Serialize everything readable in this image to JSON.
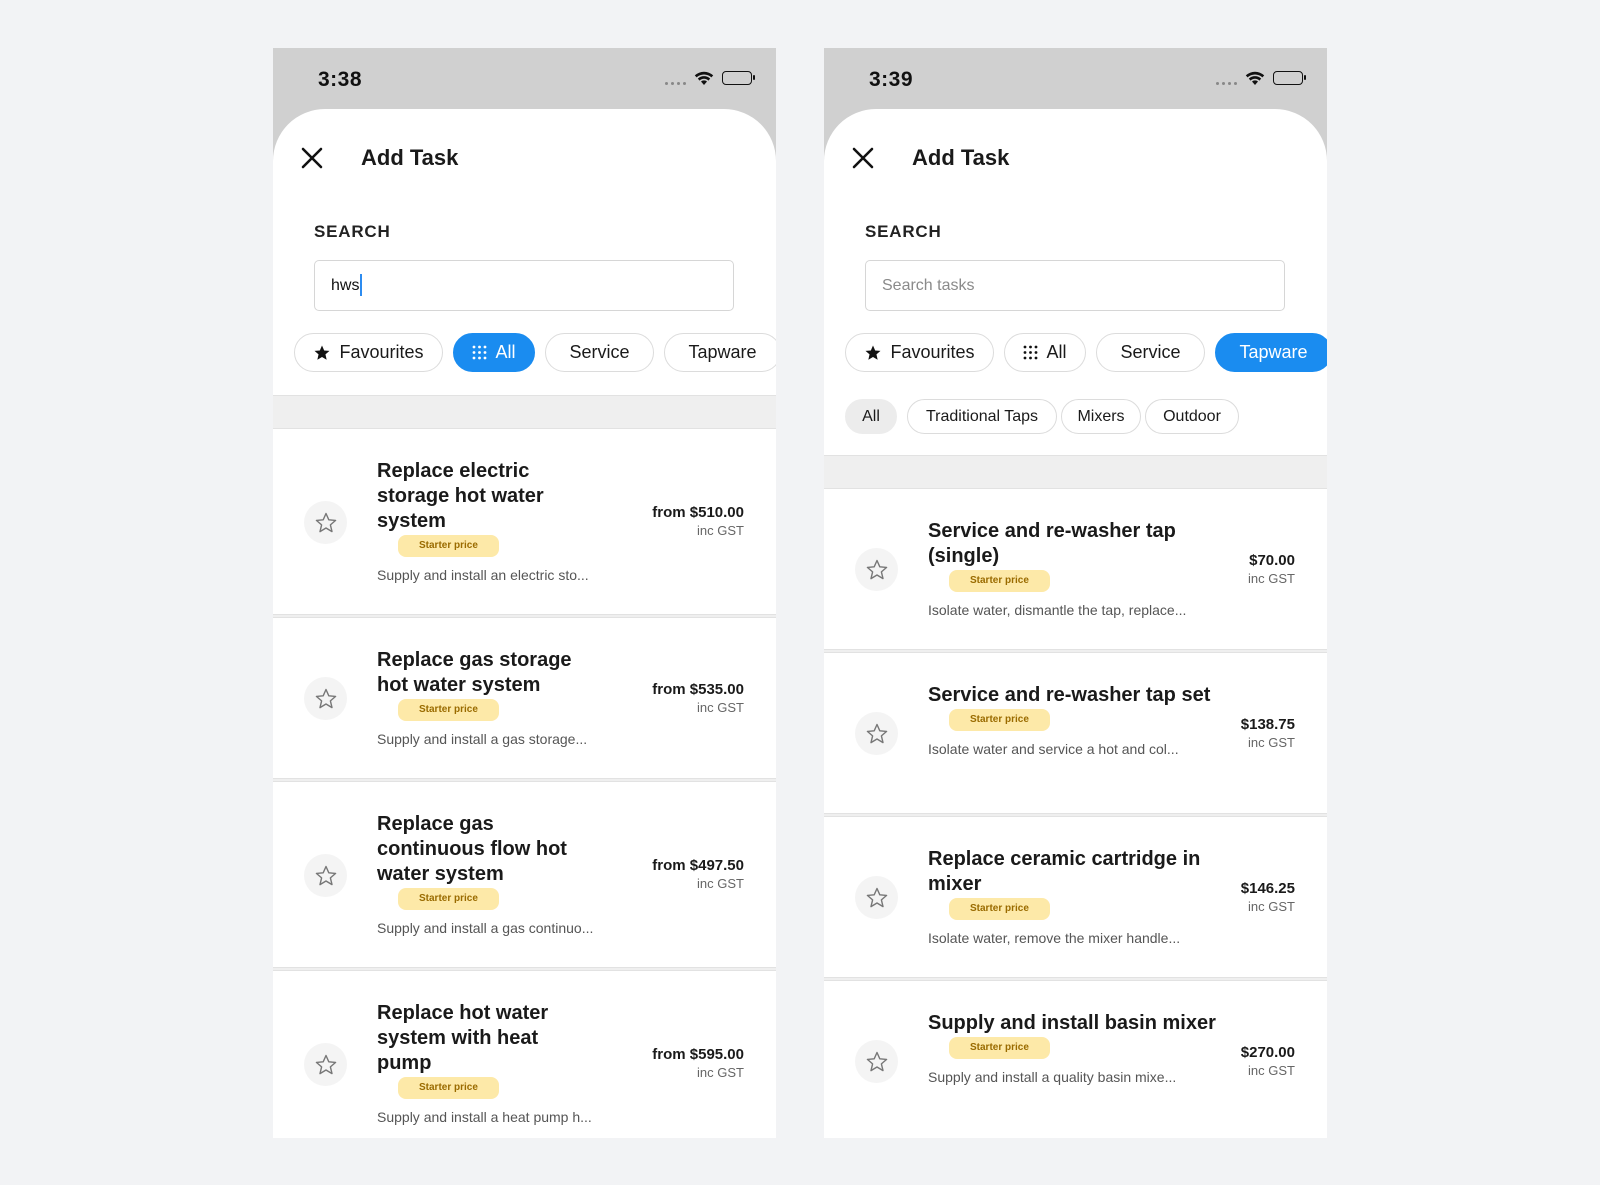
{
  "screens": [
    {
      "status_time": "3:38",
      "title": "Add Task",
      "search_label": "SEARCH",
      "search_value": "hws",
      "search_placeholder": "",
      "chips": [
        {
          "label": "Favourites",
          "icon": "star-filled-icon",
          "active": false
        },
        {
          "label": "All",
          "icon": "grid-dots-icon",
          "active": true
        },
        {
          "label": "Service",
          "icon": "",
          "active": false
        },
        {
          "label": "Tapware",
          "icon": "",
          "active": false
        }
      ],
      "subchips": [],
      "tasks": [
        {
          "title": "Replace electric storage hot water system",
          "badge": "Starter price",
          "desc": "Supply and install an electric sto...",
          "price": "from $510.00",
          "tax": "inc GST"
        },
        {
          "title": "Replace gas storage hot water system",
          "badge": "Starter price",
          "desc": "Supply and install a gas storage...",
          "price": "from $535.00",
          "tax": "inc GST"
        },
        {
          "title": "Replace gas continuous flow hot water system",
          "badge": "Starter price",
          "desc": "Supply and install a gas continuo...",
          "price": "from $497.50",
          "tax": "inc GST"
        },
        {
          "title": "Replace hot water system with heat pump",
          "badge": "Starter price",
          "desc": "Supply and install a heat pump h...",
          "price": "from $595.00",
          "tax": "inc GST"
        }
      ]
    },
    {
      "status_time": "3:39",
      "title": "Add Task",
      "search_label": "SEARCH",
      "search_value": "",
      "search_placeholder": "Search tasks",
      "chips": [
        {
          "label": "Favourites",
          "icon": "star-filled-icon",
          "active": false
        },
        {
          "label": "All",
          "icon": "grid-dots-icon",
          "active": false
        },
        {
          "label": "Service",
          "icon": "",
          "active": false
        },
        {
          "label": "Tapware",
          "icon": "",
          "active": true
        }
      ],
      "subchips": [
        {
          "label": "All",
          "active": true
        },
        {
          "label": "Traditional Taps",
          "active": false
        },
        {
          "label": "Mixers",
          "active": false
        },
        {
          "label": "Outdoor",
          "active": false
        }
      ],
      "tasks": [
        {
          "title": "Service and re-washer tap (single)",
          "badge": "Starter price",
          "desc": "Isolate water, dismantle the tap, replace...",
          "price": "$70.00",
          "tax": "inc GST"
        },
        {
          "title": "Service and re-washer tap set",
          "badge": "Starter price",
          "desc": "Isolate water and service a hot and col...",
          "price": "$138.75",
          "tax": "inc GST"
        },
        {
          "title": "Replace ceramic cartridge in mixer",
          "badge": "Starter price",
          "desc": "Isolate water, remove the mixer handle...",
          "price": "$146.25",
          "tax": "inc GST"
        },
        {
          "title": "Supply and install basin mixer",
          "badge": "Starter price",
          "desc": "Supply and install a quality basin mixe...",
          "price": "$270.00",
          "tax": "inc GST"
        }
      ]
    }
  ],
  "colors": {
    "accent": "#1a8cf0",
    "badge_bg": "#fde9a8",
    "badge_text": "#9a6b00",
    "status_bar": "#d0d0d0",
    "page_bg": "#f2f3f5"
  }
}
